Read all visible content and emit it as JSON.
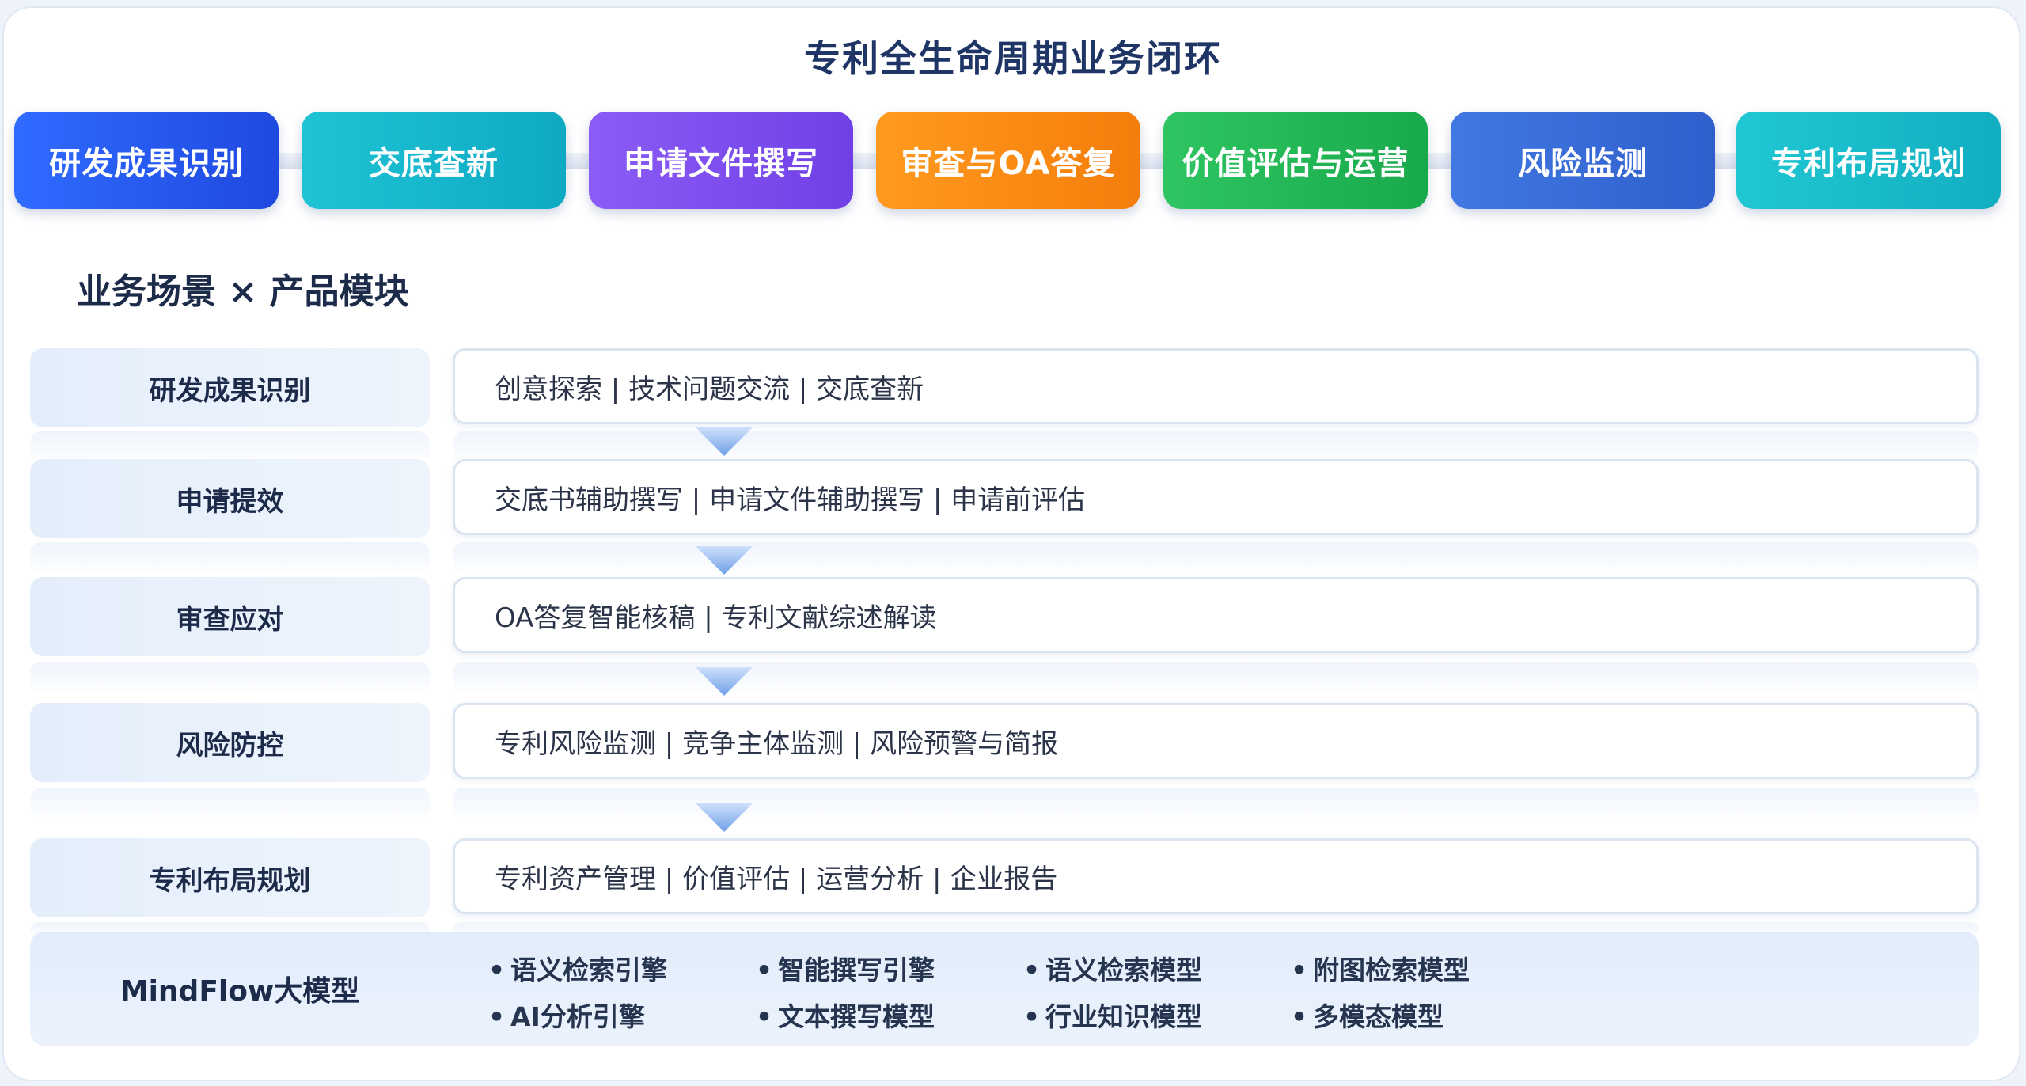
{
  "title": "专利全生命周期业务闭环",
  "stages": [
    {
      "label": "研发成果识别",
      "color_from": "#2f6bff",
      "color_to": "#1f49e0"
    },
    {
      "label": "交底查新",
      "color_from": "#1ec3d4",
      "color_to": "#0fa9c4"
    },
    {
      "label": "申请文件撰写",
      "color_from": "#8b5cf6",
      "color_to": "#7040e6"
    },
    {
      "label": "审查与OA答复",
      "color_from": "#ff9a1f",
      "color_to": "#f57d0b"
    },
    {
      "label": "价值评估与运营",
      "color_from": "#2fc562",
      "color_to": "#18a94b"
    },
    {
      "label": "风险监测",
      "color_from": "#4178e2",
      "color_to": "#2f5fcc"
    },
    {
      "label": "专利布局规划",
      "color_from": "#20c7d2",
      "color_to": "#12aec2"
    }
  ],
  "section_title": "业务场景 × 产品模块",
  "scenarios": [
    {
      "label": "研发成果识别",
      "modules": "创意探索 | 技术问题交流 | 交底查新"
    },
    {
      "label": "申请提效",
      "modules": "交底书辅助撰写 | 申请文件辅助撰写 | 申请前评估"
    },
    {
      "label": "审查应对",
      "modules": "OA答复智能核稿 | 专利文献综述解读"
    },
    {
      "label": "风险防控",
      "modules": "专利风险监测 | 竞争主体监测 | 风险预警与简报"
    },
    {
      "label": "专利布局规划",
      "modules": "专利资产管理 | 价值评估 | 运营分析 | 企业报告"
    }
  ],
  "engine": {
    "label": "MindFlow大模型",
    "items": [
      "语义检索引擎",
      "智能撰写引擎",
      "语义检索模型",
      "附图检索模型",
      "AI分析引擎",
      "文本撰写模型",
      "行业知识模型",
      "多模态模型"
    ]
  }
}
